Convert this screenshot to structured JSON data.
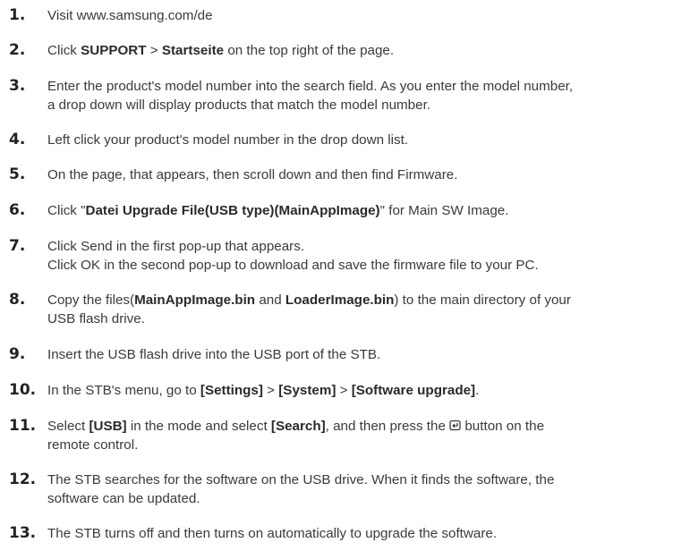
{
  "steps": [
    {
      "num": "1.",
      "lines": [
        [
          {
            "t": "Visit www.samsung.com/de"
          }
        ]
      ]
    },
    {
      "num": "2.",
      "lines": [
        [
          {
            "t": "Click "
          },
          {
            "t": "SUPPORT",
            "b": true
          },
          {
            "t": " > "
          },
          {
            "t": "Startseite",
            "b": true
          },
          {
            "t": " on the top right of the page."
          }
        ]
      ]
    },
    {
      "num": "3.",
      "lines": [
        [
          {
            "t": "Enter the product's model number into the search field. As you enter the model number,"
          }
        ],
        [
          {
            "t": "a drop down will display products that match the model number."
          }
        ]
      ]
    },
    {
      "num": "4.",
      "lines": [
        [
          {
            "t": "Left click your product's model number in the drop down list."
          }
        ]
      ]
    },
    {
      "num": "5.",
      "lines": [
        [
          {
            "t": "On the page, that appears, then scroll down and then find Firmware."
          }
        ]
      ]
    },
    {
      "num": "6.",
      "lines": [
        [
          {
            "t": "Click \""
          },
          {
            "t": "Datei Upgrade File(USB type)(MainAppImage)",
            "b": true
          },
          {
            "t": "\" for Main SW Image."
          }
        ]
      ]
    },
    {
      "num": "7.",
      "lines": [
        [
          {
            "t": "Click Send in the first pop-up that appears."
          }
        ],
        [
          {
            "t": "Click OK in the second pop-up to download and save the firmware file to your PC."
          }
        ]
      ]
    },
    {
      "num": "8.",
      "lines": [
        [
          {
            "t": "Copy the files("
          },
          {
            "t": "MainAppImage.bin",
            "b": true
          },
          {
            "t": " and "
          },
          {
            "t": "LoaderImage.bin",
            "b": true
          },
          {
            "t": ") to the main directory of your"
          }
        ],
        [
          {
            "t": "USB flash drive."
          }
        ]
      ]
    },
    {
      "num": "9.",
      "lines": [
        [
          {
            "t": "Insert the USB flash drive into the USB port of the STB."
          }
        ]
      ]
    },
    {
      "num": "10.",
      "lines": [
        [
          {
            "t": "In the STB's menu, go to "
          },
          {
            "t": "[Settings]",
            "b": true
          },
          {
            "t": " > "
          },
          {
            "t": "[System]",
            "b": true
          },
          {
            "t": " > "
          },
          {
            "t": "[Software upgrade]",
            "b": true
          },
          {
            "t": "."
          }
        ]
      ]
    },
    {
      "num": "11.",
      "lines": [
        [
          {
            "t": "Select "
          },
          {
            "t": "[USB]",
            "b": true
          },
          {
            "t": " in the mode and select "
          },
          {
            "t": "[Search]",
            "b": true
          },
          {
            "t": ", and then press the "
          },
          {
            "icon": "enter-icon"
          },
          {
            "t": " button on the"
          }
        ],
        [
          {
            "t": "remote control."
          }
        ]
      ]
    },
    {
      "num": "12.",
      "lines": [
        [
          {
            "t": "The STB searches for the software on the USB drive. When it finds the software, the"
          }
        ],
        [
          {
            "t": "software can be updated."
          }
        ]
      ]
    },
    {
      "num": "13.",
      "lines": [
        [
          {
            "t": "The STB turns off and then turns on automatically to upgrade the software."
          }
        ]
      ]
    }
  ]
}
